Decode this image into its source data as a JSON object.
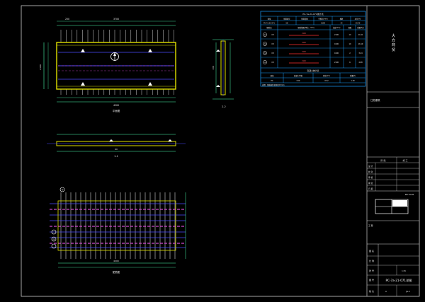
{
  "colors": {
    "background": "#000000",
    "frame": "#d8d8d8",
    "dimension": "#4cffb0",
    "slab_outline": "#e0e000",
    "bar_main": "#4a4aff",
    "bar_dashed": "#d04ad0",
    "table_line": "#1aa0ff",
    "rebar_red": "#ff3030"
  },
  "table_top": {
    "title": "PC-7a-21-071统计表",
    "headers": [
      "规格",
      "钢筋编号",
      "钢筋简图",
      "单根长(mm)",
      "根数",
      "总长(m)"
    ],
    "row": [
      "PC-7a-21-071",
      "C8",
      "—",
      "2100",
      "14",
      "29.40"
    ]
  },
  "table_rebar": {
    "header_label": "钢筋表",
    "header_sketch": "钢筋简图(单位：mm)",
    "header_cols": [
      "长度(mm)",
      "根数",
      "重量(kg)"
    ],
    "rows": [
      {
        "id": "①",
        "grade": "C8",
        "dim": "2100",
        "len": "2100",
        "num": "14",
        "wt": "11.61"
      },
      {
        "id": "②",
        "grade": "C8",
        "dim": "4100",
        "len": "4100",
        "num": "10",
        "wt": "16.19"
      },
      {
        "id": "③",
        "grade": "C8",
        "dim": "4100",
        "len": "4100",
        "num": "2",
        "wt": "3.24"
      },
      {
        "id": "④",
        "grade": "C8",
        "dim": "2100",
        "len": "2100",
        "num": "6",
        "wt": "4.98"
      }
    ]
  },
  "table_bottom": {
    "title": "混凝土统计表",
    "headers": [
      "规格",
      "混凝土等级",
      "体积(m³)",
      "重量(t)"
    ],
    "row": [
      "PC",
      "C30",
      "0.52",
      "1.30"
    ]
  },
  "note": "说明：钢筋保护层厚度15mm",
  "title_block": {
    "company": "江苏建筑",
    "project_side": "大 方 商 贸",
    "stage_label": "阶 段",
    "stage_value": "施 工",
    "rows_left": [
      "设 计",
      "校 对",
      "审 核",
      "审 定",
      "日 期"
    ],
    "key_label": "KEY PLAN",
    "drawing_name_label": "图 名",
    "drawing_name": "PC-7a-21-071详图",
    "scale_label": "比 例",
    "scale_value": "1:25",
    "no_label": "图 号",
    "no_value": "JG-1",
    "sheet_label": "张 号",
    "sheet_value": "1",
    "project_label": "工 程",
    "version_label": "版 次",
    "version_value": "A"
  },
  "plan": {
    "dim_total": "4200",
    "dim_width": "2100",
    "dim_seg_a": "250",
    "dim_seg_b": "3700",
    "caption": "平面图"
  },
  "section_side": {
    "caption": "2-2",
    "dim": "130"
  },
  "section_long": {
    "caption": "1-1",
    "dim": "60"
  },
  "rebar_view": {
    "caption": "配筋图",
    "label_a": "①",
    "label_b": "②",
    "dim": "4200"
  }
}
